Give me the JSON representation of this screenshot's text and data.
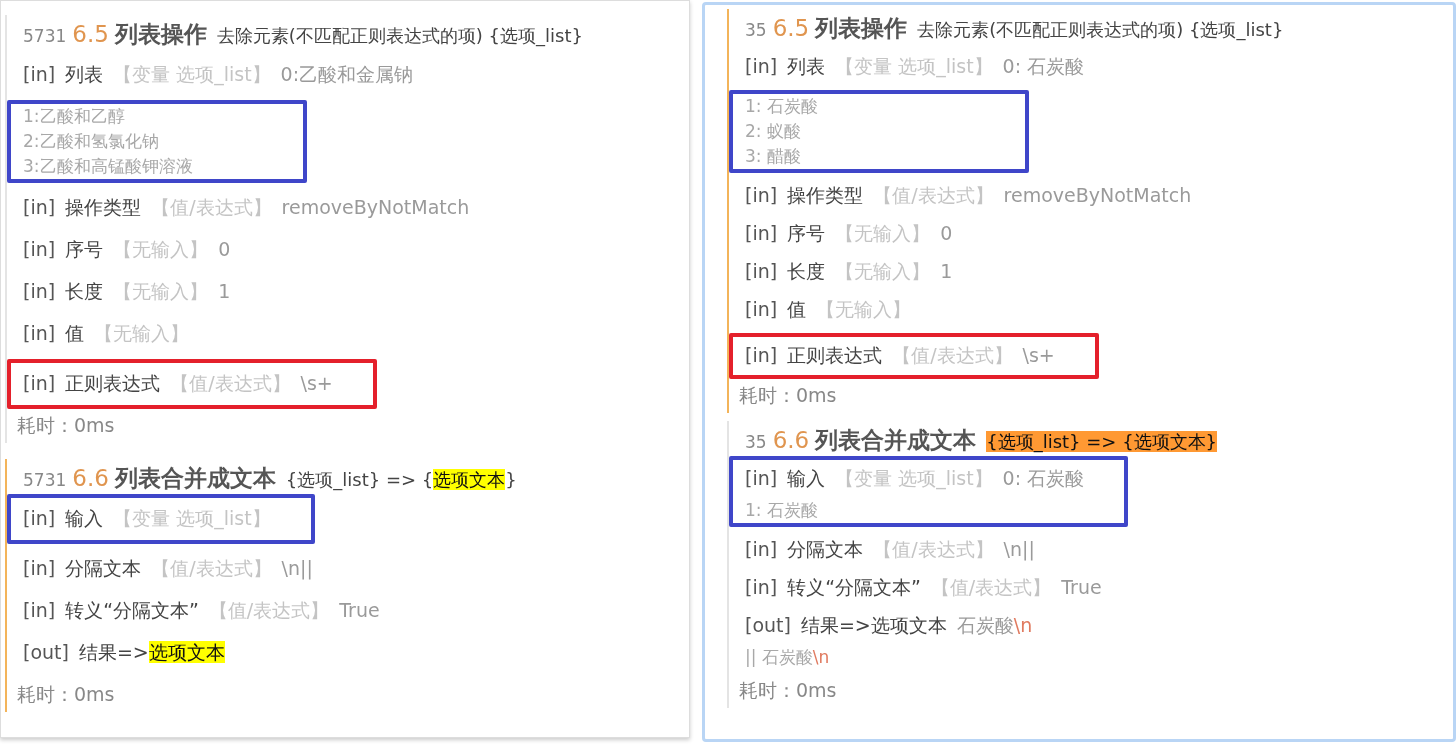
{
  "panels": [
    {
      "steps": [
        {
          "line_no": "5731",
          "number": "6.5",
          "title": "列表操作",
          "active": false,
          "subtitle": [
            {
              "text": "去除元素(不匹配正则表达式的项) {选项_list}"
            }
          ],
          "blocks": [
            {
              "rows": [
                {
                  "kind": "param",
                  "io": "[in]",
                  "name": [
                    {
                      "text": "列表"
                    }
                  ],
                  "source": "【变量 选项_list】",
                  "value": [
                    {
                      "text": "0:乙酸和金属钠"
                    }
                  ]
                }
              ]
            },
            {
              "color": "#3f46c9",
              "rows": [
                {
                  "kind": "item",
                  "value": [
                    {
                      "text": "1:乙酸和乙醇"
                    }
                  ]
                },
                {
                  "kind": "item",
                  "value": [
                    {
                      "text": "2:乙酸和氢氯化钠"
                    }
                  ]
                },
                {
                  "kind": "item",
                  "value": [
                    {
                      "text": "3:乙酸和高锰酸钾溶液"
                    }
                  ]
                }
              ]
            },
            {
              "rows": [
                {
                  "kind": "param",
                  "io": "[in]",
                  "name": [
                    {
                      "text": "操作类型"
                    }
                  ],
                  "source": "【值/表达式】",
                  "value": [
                    {
                      "text": "removeByNotMatch"
                    }
                  ]
                },
                {
                  "kind": "param",
                  "io": "[in]",
                  "name": [
                    {
                      "text": "序号"
                    }
                  ],
                  "source": "【无输入】",
                  "value": [
                    {
                      "text": "0"
                    }
                  ]
                },
                {
                  "kind": "param",
                  "io": "[in]",
                  "name": [
                    {
                      "text": "长度"
                    }
                  ],
                  "source": "【无输入】",
                  "value": [
                    {
                      "text": "1"
                    }
                  ]
                },
                {
                  "kind": "param",
                  "io": "[in]",
                  "name": [
                    {
                      "text": "值"
                    }
                  ],
                  "source": "【无输入】"
                }
              ]
            },
            {
              "color": "#e4202b",
              "rows": [
                {
                  "kind": "param",
                  "io": "[in]",
                  "name": [
                    {
                      "text": "正则表达式"
                    }
                  ],
                  "source": "【值/表达式】",
                  "value": [
                    {
                      "text": "\\s+"
                    }
                  ]
                }
              ]
            }
          ],
          "elapsed": "耗时：0ms"
        },
        {
          "line_no": "5731",
          "number": "6.6",
          "title": "列表合并成文本",
          "active": true,
          "subtitle": [
            {
              "text": "{选项_list} => {"
            },
            {
              "text": "选项文本",
              "color": "#ffff00"
            },
            {
              "text": "}"
            }
          ],
          "blocks": [
            {
              "color": "#3f46c9",
              "rows": [
                {
                  "kind": "param",
                  "io": "[in]",
                  "name": [
                    {
                      "text": "输入"
                    }
                  ],
                  "source": "【变量 选项_list】"
                }
              ]
            },
            {
              "rows": [
                {
                  "kind": "param",
                  "io": "[in]",
                  "name": [
                    {
                      "text": "分隔文本"
                    }
                  ],
                  "source": "【值/表达式】",
                  "value": [
                    {
                      "text": "\\n||"
                    }
                  ]
                },
                {
                  "kind": "param",
                  "io": "[in]",
                  "name": [
                    {
                      "text": "转义“分隔文本”"
                    }
                  ],
                  "source": "【值/表达式】",
                  "value": [
                    {
                      "text": "True"
                    }
                  ]
                },
                {
                  "kind": "param",
                  "io": "[out]",
                  "name": [
                    {
                      "text": "结果=>"
                    },
                    {
                      "text": "选项文本",
                      "color": "#ffff00"
                    }
                  ]
                }
              ]
            }
          ],
          "elapsed": "耗时：0ms"
        }
      ]
    },
    {
      "steps": [
        {
          "line_no": "35",
          "number": "6.5",
          "title": "列表操作",
          "active": true,
          "subtitle": [
            {
              "text": "去除元素(不匹配正则表达式的项) {选项_list}"
            }
          ],
          "blocks": [
            {
              "rows": [
                {
                  "kind": "param",
                  "io": "[in]",
                  "name": [
                    {
                      "text": "列表"
                    }
                  ],
                  "source": "【变量 选项_list】",
                  "value": [
                    {
                      "text": "0: 石炭酸"
                    }
                  ]
                }
              ]
            },
            {
              "color": "#3f46c9",
              "rows": [
                {
                  "kind": "item",
                  "value": [
                    {
                      "text": "1: 石炭酸"
                    }
                  ]
                },
                {
                  "kind": "item",
                  "value": [
                    {
                      "text": "2: 蚁酸"
                    }
                  ]
                },
                {
                  "kind": "item",
                  "value": [
                    {
                      "text": "3: 醋酸"
                    }
                  ]
                }
              ]
            },
            {
              "rows": [
                {
                  "kind": "param",
                  "io": "[in]",
                  "name": [
                    {
                      "text": "操作类型"
                    }
                  ],
                  "source": "【值/表达式】",
                  "value": [
                    {
                      "text": "removeByNotMatch"
                    }
                  ]
                },
                {
                  "kind": "param",
                  "io": "[in]",
                  "name": [
                    {
                      "text": "序号"
                    }
                  ],
                  "source": "【无输入】",
                  "value": [
                    {
                      "text": "0"
                    }
                  ]
                },
                {
                  "kind": "param",
                  "io": "[in]",
                  "name": [
                    {
                      "text": "长度"
                    }
                  ],
                  "source": "【无输入】",
                  "value": [
                    {
                      "text": "1"
                    }
                  ]
                },
                {
                  "kind": "param",
                  "io": "[in]",
                  "name": [
                    {
                      "text": "值"
                    }
                  ],
                  "source": "【无输入】"
                }
              ]
            },
            {
              "color": "#e4202b",
              "rows": [
                {
                  "kind": "param",
                  "io": "[in]",
                  "name": [
                    {
                      "text": "正则表达式"
                    }
                  ],
                  "source": "【值/表达式】",
                  "value": [
                    {
                      "text": "\\s+"
                    }
                  ]
                }
              ]
            }
          ],
          "elapsed": "耗时：0ms"
        },
        {
          "line_no": "35",
          "number": "6.6",
          "title": "列表合并成文本",
          "active": false,
          "subtitle": [
            {
              "text": "{选项_list} => {选项文本}",
              "color": "#ff9933"
            }
          ],
          "blocks": [
            {
              "color": "#3f46c9",
              "rows": [
                {
                  "kind": "param",
                  "io": "[in]",
                  "name": [
                    {
                      "text": "输入"
                    }
                  ],
                  "source": "【变量 选项_list】",
                  "value": [
                    {
                      "text": "0: 石炭酸"
                    }
                  ]
                },
                {
                  "kind": "item",
                  "value": [
                    {
                      "text": "1: 石炭酸"
                    }
                  ]
                }
              ]
            },
            {
              "rows": [
                {
                  "kind": "param",
                  "io": "[in]",
                  "name": [
                    {
                      "text": "分隔文本"
                    }
                  ],
                  "source": "【值/表达式】",
                  "value": [
                    {
                      "text": "\\n||"
                    }
                  ]
                },
                {
                  "kind": "param",
                  "io": "[in]",
                  "name": [
                    {
                      "text": "转义“分隔文本”"
                    }
                  ],
                  "source": "【值/表达式】",
                  "value": [
                    {
                      "text": "True"
                    }
                  ]
                },
                {
                  "kind": "param",
                  "io": "[out]",
                  "name": [
                    {
                      "text": "结果=>选项文本"
                    }
                  ],
                  "value": [
                    {
                      "text": "石炭酸"
                    },
                    {
                      "text": "\\n",
                      "escape": true
                    }
                  ]
                },
                {
                  "kind": "item",
                  "value": [
                    {
                      "text": "|| 石炭酸"
                    },
                    {
                      "text": "\\n",
                      "escape": true
                    }
                  ]
                }
              ]
            }
          ],
          "elapsed": "耗时：0ms"
        }
      ]
    }
  ]
}
